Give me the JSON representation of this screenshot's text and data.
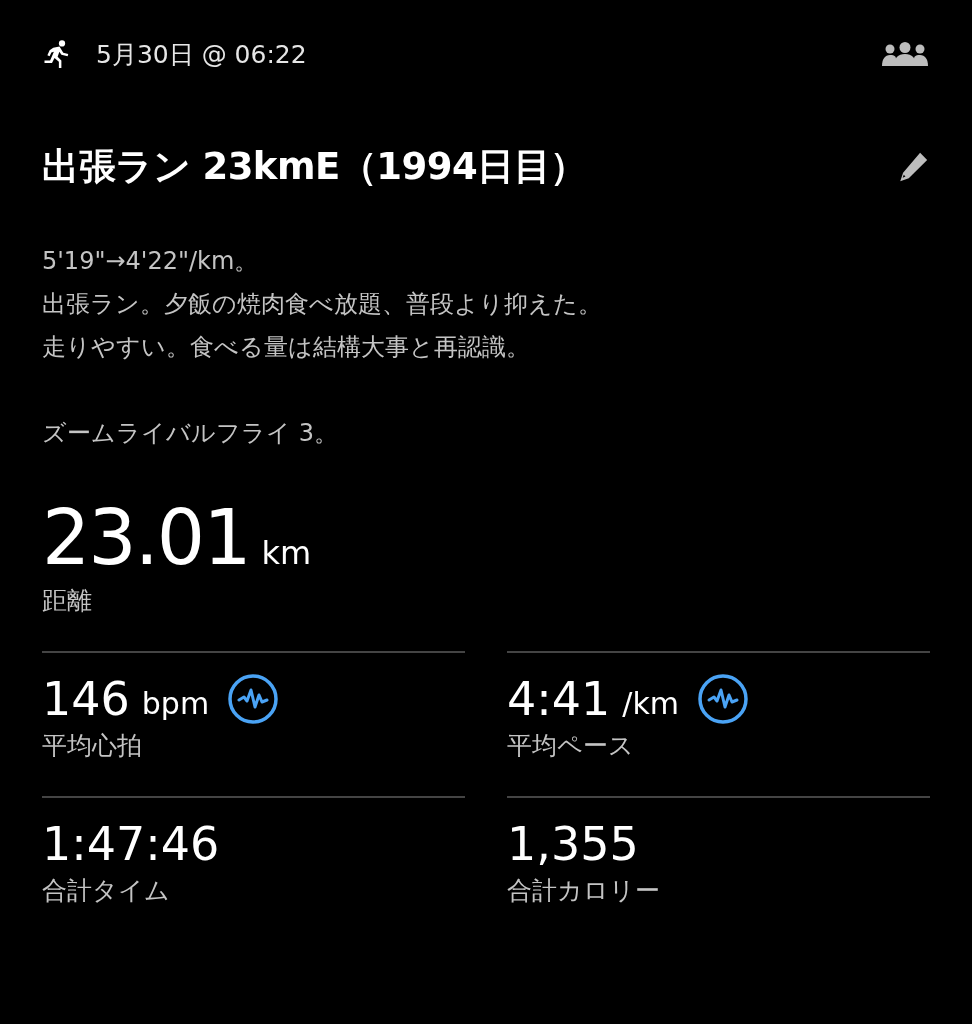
{
  "header": {
    "date": "5月30日 @ 06:22"
  },
  "title": "出張ラン 23kmE（1994日目）",
  "description": [
    [
      "5'19\"→4'22\"/km。",
      "出張ラン。夕飯の焼肉食べ放題、普段より抑えた。",
      "走りやすい。食べる量は結構大事と再認識。"
    ],
    [
      "ズームライバルフライ 3。"
    ]
  ],
  "distance": {
    "value": "23.01",
    "unit": "km",
    "label": "距離"
  },
  "stats": [
    {
      "value": "146",
      "unit": "bpm",
      "label": "平均心拍",
      "has_chart": true
    },
    {
      "value": "4:41",
      "unit": "/km",
      "label": "平均ペース",
      "has_chart": true
    },
    {
      "value": "1:47:46",
      "label": "合計タイム",
      "has_chart": false
    },
    {
      "value": "1,355",
      "label": "合計カロリー",
      "has_chart": false
    }
  ]
}
